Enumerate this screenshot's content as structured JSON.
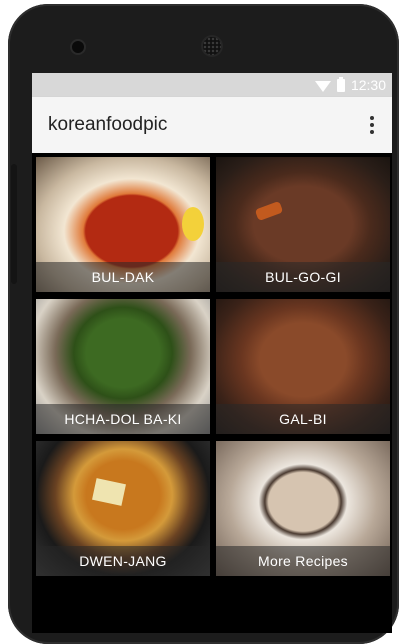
{
  "statusbar": {
    "time": "12:30"
  },
  "appbar": {
    "title": "koreanfoodpic",
    "menu_icon": "more-vert-icon"
  },
  "tiles": [
    {
      "label": "BUL-DAK"
    },
    {
      "label": "BUL-GO-GI"
    },
    {
      "label": "HCHA-DOL BA-KI"
    },
    {
      "label": "GAL-BI"
    },
    {
      "label": "DWEN-JANG"
    },
    {
      "label": "More Recipes"
    }
  ]
}
